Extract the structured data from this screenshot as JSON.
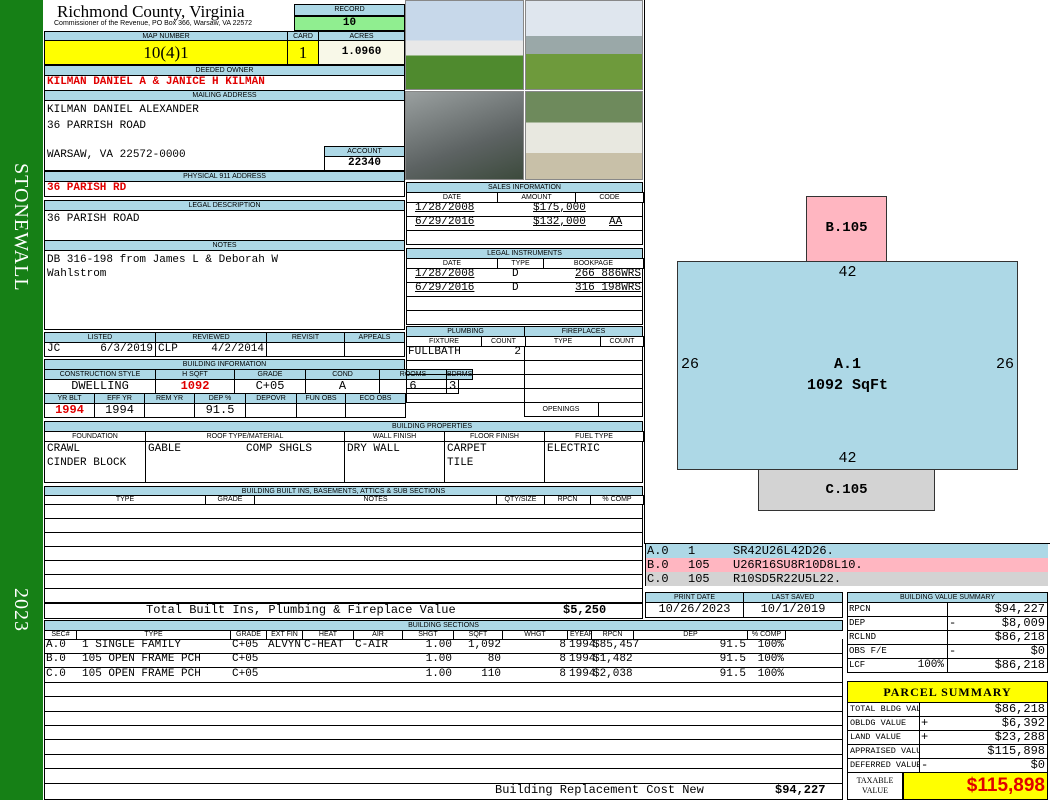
{
  "sidebar": {
    "district": "STONEWALL",
    "year": "2023"
  },
  "header": {
    "county": "Richmond County, Virginia",
    "office": "Commissioner of the Revenue, PO Box 366, Warsaw, VA 22572",
    "record_label": "RECORD",
    "record": "10",
    "map_label": "MAP NUMBER",
    "map": "10(4)1",
    "card_label": "CARD",
    "card": "1",
    "acres_label": "ACRES",
    "acres": "1.0960"
  },
  "owner": {
    "label": "DEEDED OWNER",
    "value": "KILMAN DANIEL A & JANICE H KILMAN"
  },
  "mailing": {
    "label": "MAILING ADDRESS",
    "line1": "KILMAN DANIEL ALEXANDER",
    "line2": "36 PARRISH ROAD",
    "line3": "WARSAW, VA 22572-0000",
    "account_label": "ACCOUNT",
    "account": "22340"
  },
  "physical": {
    "label": "PHYSICAL 911 ADDRESS",
    "value": "36 PARISH RD"
  },
  "legal": {
    "label": "LEGAL DESCRIPTION",
    "value": "36 PARISH ROAD"
  },
  "notes": {
    "label": "NOTES",
    "line1": "DB 316-198 from James L & Deborah W",
    "line2": "Wahlstrom"
  },
  "listing": {
    "listed_label": "LISTED",
    "listed_by": "JC",
    "listed_date": "6/3/2019",
    "reviewed_label": "REVIEWED",
    "reviewed_by": "CLP",
    "reviewed_date": "4/2/2014",
    "revisit_label": "REVISIT",
    "appeals_label": "APPEALS"
  },
  "building_info": {
    "label": "BUILDING INFORMATION",
    "headers1": [
      "CONSTRUCTION STYLE",
      "H SQFT",
      "GRADE",
      "COND",
      "ROOMS",
      "BDRMS"
    ],
    "values1": [
      "DWELLING",
      "1092",
      "C+05",
      "A",
      "6",
      "3"
    ],
    "headers2": [
      "YR BLT",
      "EFF YR",
      "REM YR",
      "DEP %",
      "DEPOVR",
      "FUN OBS",
      "ECO OBS"
    ],
    "values2": [
      "1994",
      "1994",
      "",
      "91.5",
      "",
      "",
      ""
    ]
  },
  "properties": {
    "label": "BUILDING PROPERTIES",
    "headers": [
      "FOUNDATION",
      "ROOF TYPE/MATERIAL",
      "WALL FINISH",
      "FLOOR FINISH",
      "FUEL TYPE"
    ],
    "foundation": [
      "CRAWL",
      "CINDER BLOCK"
    ],
    "roof_type": "GABLE",
    "roof_material": "COMP SHGLS",
    "wall": "DRY WALL",
    "floor": [
      "CARPET",
      "TILE"
    ],
    "fuel": "ELECTRIC"
  },
  "builtins": {
    "label": "BUILDING BUILT INS, BASEMENTS, ATTICS & SUB SECTIONS",
    "headers": [
      "TYPE",
      "GRADE",
      "NOTES",
      "QTY/SIZE",
      "RPCN",
      "% COMP"
    ],
    "total_label": "Total Built Ins, Plumbing & Fireplace Value",
    "total": "$5,250"
  },
  "sections": {
    "label": "BUILDING SECTIONS",
    "headers": [
      "SEC#",
      "TYPE",
      "GRADE",
      "EXT FIN",
      "HEAT",
      "AIR",
      "SHGT",
      "SQFT",
      "WHGT",
      "EYEAR",
      "RPCN",
      "DEP",
      "% COMP"
    ],
    "rows": [
      [
        "A.0",
        "1 SINGLE FAMILY",
        "C+05",
        "ALVYN",
        "C-HEAT",
        "C-AIR",
        "1.00",
        "1,092",
        "8",
        "1994",
        "$85,457",
        "91.5",
        "100%"
      ],
      [
        "B.0",
        "105 OPEN FRAME PCH",
        "C+05",
        "",
        "",
        "",
        "1.00",
        "80",
        "8",
        "1994",
        "$1,482",
        "91.5",
        "100%"
      ],
      [
        "C.0",
        "105 OPEN FRAME PCH",
        "C+05",
        "",
        "",
        "",
        "1.00",
        "110",
        "8",
        "1994",
        "$2,038",
        "91.5",
        "100%"
      ]
    ],
    "footer_label": "Building Replacement Cost New",
    "footer_value": "$94,227"
  },
  "sales": {
    "label": "SALES INFORMATION",
    "headers": [
      "DATE",
      "AMOUNT",
      "CODE"
    ],
    "rows": [
      [
        "1/28/2008",
        "$175,000",
        ""
      ],
      [
        "6/29/2016",
        "$132,000",
        "AA"
      ]
    ]
  },
  "instruments": {
    "label": "LEGAL INSTRUMENTS",
    "headers": [
      "DATE",
      "TYPE",
      "BOOKPAGE"
    ],
    "rows": [
      [
        "1/28/2008",
        "D",
        "266 886WRS"
      ],
      [
        "6/29/2016",
        "D",
        "316 198WRS"
      ]
    ]
  },
  "plumbing": {
    "label": "PLUMBING",
    "headers": [
      "FIXTURE",
      "COUNT"
    ],
    "rows": [
      [
        "FULLBATH",
        "2"
      ]
    ]
  },
  "fireplaces": {
    "label": "FIREPLACES",
    "headers": [
      "TYPE",
      "COUNT"
    ],
    "openings_label": "OPENINGS"
  },
  "sketch": {
    "a_label": "A.1",
    "a_area": "1092 SqFt",
    "b_label": "B.105",
    "c_label": "C.105",
    "top": "42",
    "bottom": "42",
    "left": "26",
    "right": "26",
    "lines": [
      {
        "sec": "A.0",
        "code": "1",
        "path": "SR42U26L42D26.",
        "color": "#add8e6"
      },
      {
        "sec": "B.0",
        "code": "105",
        "path": "U26R16SU8R10D8L10.",
        "color": "#ffb6c1"
      },
      {
        "sec": "C.0",
        "code": "105",
        "path": "R10SD5R22U5L22.",
        "color": "#d3d3d3"
      }
    ]
  },
  "dates": {
    "print_label": "PRINT DATE",
    "print": "10/26/2023",
    "saved_label": "LAST SAVED",
    "saved": "10/1/2019"
  },
  "value_summary": {
    "label": "BUILDING VALUE SUMMARY",
    "rows": [
      [
        "RPCN",
        "",
        "",
        "$94,227"
      ],
      [
        "DEP",
        "",
        "-",
        "$8,009"
      ],
      [
        "RCLND",
        "",
        "",
        "$86,218"
      ],
      [
        "OBS F/E",
        "",
        "-",
        "$0"
      ],
      [
        "LCF",
        "100%",
        "",
        "$86,218"
      ]
    ]
  },
  "parcel": {
    "label": "PARCEL SUMMARY",
    "rows": [
      [
        "TOTAL BLDG VALUE",
        "",
        "$86,218"
      ],
      [
        "OBLDG VALUE",
        "+",
        "$6,392"
      ],
      [
        "LAND VALUE",
        "+",
        "$23,288"
      ],
      [
        "APPRAISED VALUE",
        "",
        "$115,898"
      ],
      [
        "DEFERRED VALUE",
        "-",
        "$0"
      ]
    ],
    "taxable_label1": "TAXABLE",
    "taxable_label2": "VALUE",
    "taxable": "$115,898"
  }
}
